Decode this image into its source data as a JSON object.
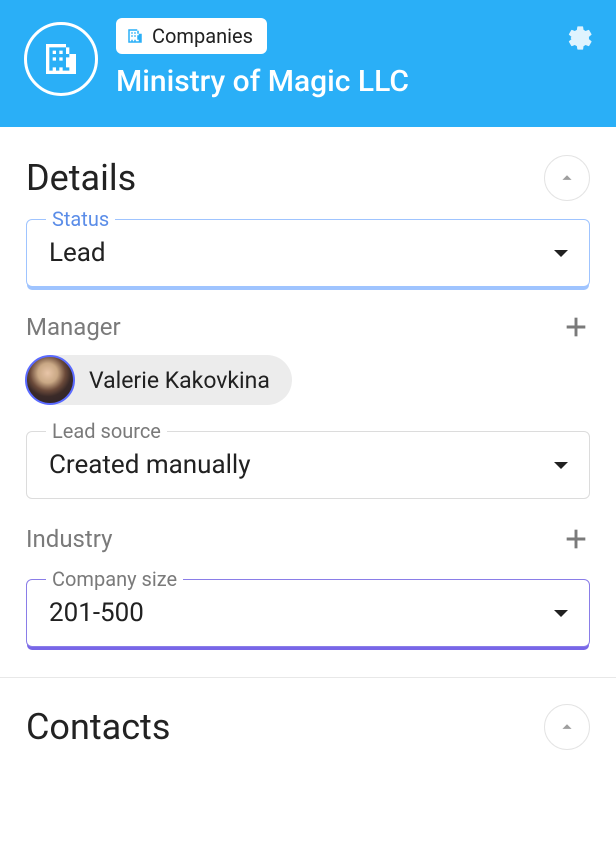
{
  "header": {
    "breadcrumb_label": "Companies",
    "company_name": "Ministry of Magic LLC"
  },
  "sections": {
    "details": {
      "title": "Details",
      "fields": {
        "status": {
          "label": "Status",
          "value": "Lead"
        },
        "manager": {
          "label": "Manager",
          "assignee_name": "Valerie Kakovkina"
        },
        "lead_source": {
          "label": "Lead source",
          "value": "Created manually"
        },
        "industry": {
          "label": "Industry"
        },
        "company_size": {
          "label": "Company size",
          "value": "201-500"
        }
      }
    },
    "contacts": {
      "title": "Contacts"
    }
  }
}
